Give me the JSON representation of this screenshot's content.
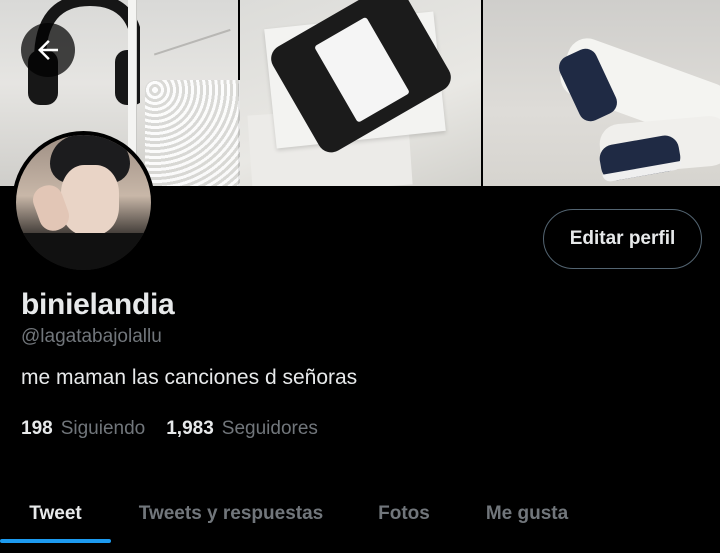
{
  "header": {
    "back_icon": "arrow-left-icon"
  },
  "profile": {
    "display_name": "binielandia",
    "handle": "@lagatabajolallu",
    "bio": "me maman las canciones d señoras",
    "edit_button_label": "Editar perfil"
  },
  "stats": {
    "following_count": "198",
    "following_label": "Siguiendo",
    "followers_count": "1,983",
    "followers_label": "Seguidores"
  },
  "tabs": [
    {
      "label": "Tweet",
      "active": true
    },
    {
      "label": "Tweets y respuestas",
      "active": false
    },
    {
      "label": "Fotos",
      "active": false
    },
    {
      "label": "Me gusta",
      "active": false
    }
  ],
  "colors": {
    "background": "#000000",
    "accent": "#1d9bf0",
    "secondary_text": "#71767b",
    "primary_text": "#e7e9ea"
  }
}
